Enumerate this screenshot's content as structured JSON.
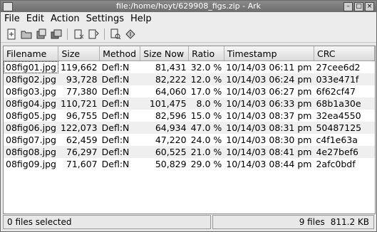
{
  "window": {
    "title": "file:/home/hoyt/629908_figs.zip - Ark"
  },
  "menu": [
    "File",
    "Edit",
    "Action",
    "Settings",
    "Help"
  ],
  "toolbar": {
    "items": [
      "new-archive-icon",
      "open-archive-icon",
      "add-files-icon",
      "add-folder-icon",
      "delete-icon",
      "extract-icon",
      "view-icon",
      "open-with-icon"
    ]
  },
  "table": {
    "columns": [
      "Filename",
      "Size",
      "Method",
      "Size Now",
      "Ratio",
      "Timestamp",
      "CRC"
    ],
    "rows": [
      [
        "08fig01.jpg",
        "119,662",
        "Defl:N",
        "81,431",
        "32.0 %",
        "10/14/03 06:11 pm",
        "27cee6d2"
      ],
      [
        "08fig02.jpg",
        "93,728",
        "Defl:N",
        "82,222",
        "12.0 %",
        "10/14/03 06:24 pm",
        "033e471f"
      ],
      [
        "08fig03.jpg",
        "77,380",
        "Defl:N",
        "64,060",
        "17.0 %",
        "10/14/03 06:27 pm",
        "6f62cf47"
      ],
      [
        "08fig04.jpg",
        "110,721",
        "Defl:N",
        "101,475",
        "8.0 %",
        "10/14/03 06:33 pm",
        "68b1a30e"
      ],
      [
        "08fig05.jpg",
        "96,755",
        "Defl:N",
        "82,596",
        "15.0 %",
        "10/14/03 08:37 pm",
        "32ea4550"
      ],
      [
        "08fig06.jpg",
        "122,073",
        "Defl:N",
        "64,934",
        "47.0 %",
        "10/14/03 08:31 pm",
        "50487125"
      ],
      [
        "08fig07.jpg",
        "62,459",
        "Defl:N",
        "47,220",
        "24.0 %",
        "10/14/03 08:30 pm",
        "c4f1e63a"
      ],
      [
        "08fig08.jpg",
        "76,297",
        "Defl:N",
        "60,525",
        "21.0 %",
        "10/14/03 08:41 pm",
        "4e27bef6"
      ],
      [
        "08fig09.jpg",
        "71,607",
        "Defl:N",
        "50,829",
        "29.0 %",
        "10/14/03 08:44 pm",
        "2afc0bdf"
      ]
    ]
  },
  "status": {
    "selected": "0 files selected",
    "files": "9 files",
    "size": "811.2 KB"
  }
}
